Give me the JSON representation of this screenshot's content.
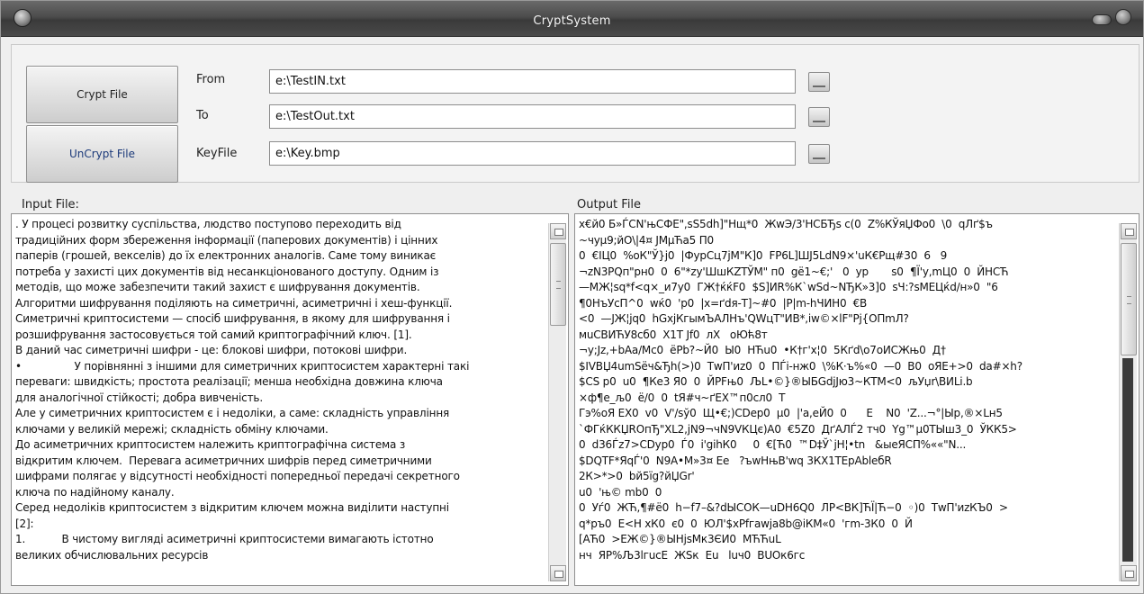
{
  "window": {
    "title": "CryptSystem"
  },
  "buttons": {
    "crypt": "Crypt File",
    "uncrypt": "UnCrypt File"
  },
  "fields": {
    "from": {
      "label": "From",
      "value": "e:\\TestIN.txt"
    },
    "to": {
      "label": "To",
      "value": "e:\\TestOut.txt"
    },
    "keyfile": {
      "label": "KeyFile",
      "value": "e:\\Key.bmp"
    }
  },
  "input": {
    "label": "Input File:",
    "text": ". У процесі розвитку суспільства, людство поступово переходить від\nтрадиційних форм збереження інформації (паперових документів) і цінних\nпаперів (грошей, векселів) до їх електронних аналогів. Саме тому виникає\nпотреба у захисті цих документів від несанкціонованого доступу. Одним із\nметодів, що може забезпечити такий захист є шифрування документів.\nАлгоритми шифрування поділяють на симетричні, асиметричні і хеш-функції.\nСиметричні криптосистеми — спосіб шифрування, в якому для шифрування і\nрозшифрування застосовується той самий криптографічний ключ. [1].\nВ даний час симетричні шифри - це: блокові шифри, потокові шифри.\n•                У порівнянні з іншими для симетричних криптосистем характерні такі\nпереваги: швидкість; простота реалізації; менша необхідна довжина ключа\nдля аналогічної стійкості; добра вивченість.\nАле у симетричних криптосистем є і недоліки, а саме: складність управління\nключами у великій мережі; складність обміну ключами.\nДо асиметричних криптосистем належить криптографічна система з\nвідкритим ключем.  Перевага асиметричних шифрів перед симетричними\nшифрами полягає у відсутності необхідності попередньої передачі секретного\nключа по надійному каналу.\nСеред недоліків криптосистем з відкритим ключем можна виділити наступні\n[2]:\n1.           В чистому вигляді асиметричні криптосистеми вимагають істотно\nвеликих обчислювальних ресурсів"
  },
  "output": {
    "label": "Output File",
    "text": "x€й0 Б»ЃCN'њСФЕ\",ѕS5dh]\"Нщ*0  ЖwЭ/3'НСБЂs с(0  Z%КЎяЏФо0  \\0  qЛґ$ъ\n~чуµ9;йО\\|4¤ JМµЋа5 П0\n0  €IЦ0  %оК\"Ў}ј0  |ФурСц7јМ\"К]0  FР6L]ШЈ5LdN9×'uК€Рщ#30  6   9\n¬zN3PQп\"pн0  0  6\"*zy'ШшКZТЎМ\" п0  gё1~€;'   0  yp       s0  ¶Ї'у,mЦ0  0  ЙНСЋ\n—МЖ¦sq*f<q×_и7у0  ГЖ†ќќF0  $S]ИR%К`wSd~NЂК»3]0  sЧ:?sМЕЦќd/н»0  \"6\n¶0НъУсП^0  wќ0  'р0  |х=ґdя-Т]~#0  |P|m-hЧИН0  €В\n<0  —ЈЖ¦jq0  hGхјКгымЪАЛНъ'QWцТ\"ИВ*,iw©×lF\"Pj{ОПmЛ?\nмuСВИЋУ8сб0  Х1Т Jf0  лХ   оЮћ8т\n¬у;Jz,+bАа/Мс0  ёРb?~Й0  Ы0  НЋu0  •К†г'х¦0  5Кґd\\о7оИСЖњ0  Д†\n$IVВЏ4umSёч&Ђh(>)0  ТwП'иz0  0  ПЃі-нж0  \\%К·ъ%«0  —0  В0  оЯЕ+>0  dа#×h?\n$CS р0  u0  ¶Ке3 Я0  0  ЙРFњ0  ЉL•©}®ЫБGdjЈю3~КТМ<0  љУџr\\ВИLi.b\n×ф¶е_љ0  ё/0  0  tЯ#ч~ґЕХ™п0сл0  Т\nГэ%оЯ ЕХ0  v0  V'/sў0  Щ•€;)CDep0  µ0  |'а,еЙ0  0      Е    N0  'Z...¬°|Ыр,®×Lн5\n`ФГќККЏRОпЂ\"ХL2,јN9¬чN9VКЦє)А0  €5Z0  ДґАЛЃ2 тч0  Yg™µ0ТЫш3_0  ЎКК5>\n0  d36Ѓz7>CDyp0  Ѓ0  і'gіhК0     0  €[Ћ0  ™D‡Ў`јН¦•tn   &ыеЯСП%««\"N...\n$DQTF*ЯqЃ'0  N9А•М»3¤ Ее   ?ъwНњВ'wq 3КХ1ТЕрАbleбR\n2К>*>0  bй5їg?йЏGr'\nu0  'њ© mb0  0\n0  Уѓ0  ЖЋ,¶#ё0  h−f7–&?dЫСОК—uDН6Q0  ЛР<ВК]ЋЇ|Ћ−0  ◦)0  ТwП'иzКЪ0  >\nq*ръ0  Е<Н хК0  є0  0  ЮЛ'$хРfгаwјa8b@іКМ«0  'гm-3К0  0  Й\n[АЋ0  >ЕЖ©}®ЫНјsМк3ЄИ0  МЋЋuL\nнч  ЯР%Љ3lгucE  ЖЅк  Еu   luч0  ВUОк6гс"
  }
}
